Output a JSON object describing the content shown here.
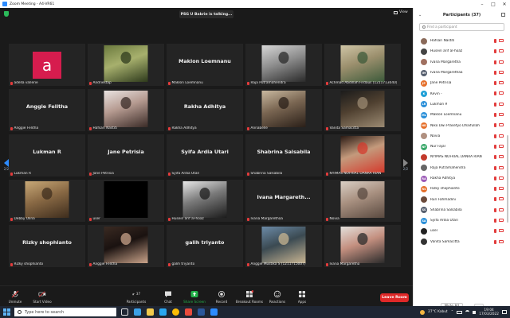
{
  "window": {
    "title": "Zoom Meeting - A4-VR61",
    "controls": [
      "–",
      "□",
      "✕"
    ]
  },
  "banner": {
    "talking": "PSG U Bakrie is talking..."
  },
  "view": {
    "label": "View"
  },
  "pager": {
    "left": "2/2",
    "right": "2/2"
  },
  "tiles": [
    {
      "name": "adella vallerie",
      "kind": "avatar",
      "letter": "a"
    },
    {
      "name": "Andriestap",
      "kind": "photo",
      "palette": [
        "#6b7a3e",
        "#2e3a1c",
        "#a7b06d"
      ]
    },
    {
      "name": "Maklon Loemnanu",
      "kind": "text",
      "big": "Maklon Loemnanu"
    },
    {
      "name": "Raja Putramahendra",
      "kind": "photo",
      "palette": [
        "#d7d7d7",
        "#2a2a2a",
        "#8f8f8f"
      ]
    },
    {
      "name": "Achmad Abdillah Firdaus (1211713040)",
      "kind": "photo",
      "palette": [
        "#cfc5a6",
        "#3c5a3a",
        "#9b8f6d"
      ]
    },
    {
      "name": "Anggie Felitha",
      "kind": "text",
      "big": "Anggie Felitha"
    },
    {
      "name": "Hafsari Nastiti",
      "kind": "photo",
      "palette": [
        "#e9e3e1",
        "#3a2b27",
        "#b59a90"
      ]
    },
    {
      "name": "Rakha Adhitya",
      "kind": "text",
      "big": "Rakha Adhitya"
    },
    {
      "name": "Annabelle",
      "kind": "photo",
      "palette": [
        "#c9b9a0",
        "#2a1f18",
        "#7a6652"
      ]
    },
    {
      "name": "Vanita Samacitta",
      "kind": "photo",
      "palette": [
        "#1b1b1b",
        "#9b8a72",
        "#4f4030"
      ]
    },
    {
      "name": "Lukman R",
      "kind": "text",
      "big": "Lukman R"
    },
    {
      "name": "Jane Petrisia",
      "kind": "text",
      "big": "Jane Petrisia"
    },
    {
      "name": "Syifa Ardia Utari",
      "kind": "text",
      "big": "Syifa Ardia Utari"
    },
    {
      "name": "Shabrina Salsabila",
      "kind": "text",
      "big": "Shabrina Salsabila"
    },
    {
      "name": "NYIMAS NOFRIAL DANRA RIAN",
      "kind": "photo",
      "palette": [
        "#2a1a14",
        "#d43a2c",
        "#c49a7c"
      ]
    },
    {
      "name": "Debby Ulina",
      "kind": "photo",
      "palette": [
        "#c8a978",
        "#3e2d1d",
        "#8a6a45"
      ]
    },
    {
      "name": "user",
      "kind": "black"
    },
    {
      "name": "Husein arif al-hoaz",
      "kind": "photo",
      "palette": [
        "#e8e8e8",
        "#1c1c1c",
        "#7a7a7a"
      ]
    },
    {
      "name": "Ivana Margarethaa",
      "kind": "text",
      "big": "Ivana Margareth..."
    },
    {
      "name": "Novia",
      "kind": "photo",
      "palette": [
        "#d9cfc5",
        "#5a4a40",
        "#a89080"
      ]
    },
    {
      "name": "Rizky shophianto",
      "kind": "text",
      "big": "Rizky shophianto"
    },
    {
      "name": "Anggie Felitha",
      "kind": "photo",
      "palette": [
        "#3a2a22",
        "#caa38a",
        "#1a1210"
      ]
    },
    {
      "name": "galih triyanto",
      "kind": "text",
      "big": "galih triyanto"
    },
    {
      "name": "Anggie Mustika S (1211715007)",
      "kind": "photo",
      "palette": [
        "#6c8ba8",
        "#c8b592",
        "#3b4a52"
      ]
    },
    {
      "name": "Ivana Margaretha",
      "kind": "photo",
      "palette": [
        "#e3e0dc",
        "#2b2b2b",
        "#c49080"
      ]
    }
  ],
  "toolbar": {
    "unmute": "Unmute",
    "start_video": "Start Video",
    "participants": "Participants",
    "participants_count": "37",
    "chat": "Chat",
    "share_screen": "Share Screen",
    "record": "Record",
    "breakout_rooms": "Breakout Rooms",
    "reactions": "Reactions",
    "apps": "Apps",
    "leave": "Leave Room"
  },
  "panel": {
    "title": "Participants (37)",
    "search_placeholder": "Find a participant",
    "participants": [
      {
        "name": "Hafsari Nastiti",
        "initials": "",
        "color": "#8a6a5a"
      },
      {
        "name": "Husein arif al-hoaz",
        "initials": "",
        "color": "#444444"
      },
      {
        "name": "Ivana Margaretha",
        "initials": "",
        "color": "#a07060"
      },
      {
        "name": "Ivana Margarethaa",
        "initials": "IM",
        "color": "#555e6e"
      },
      {
        "name": "Jane Petrisia",
        "initials": "JP",
        "color": "#e56f2a"
      },
      {
        "name": "Kevin -",
        "initials": "K",
        "color": "#1e9fd6"
      },
      {
        "name": "Lukman R",
        "initials": "LR",
        "color": "#2a8fd8"
      },
      {
        "name": "Maklon Loemnanu",
        "initials": "ML",
        "color": "#2a8fd8"
      },
      {
        "name": "Niko Dwi Prasetyo Dhaifullah",
        "initials": "ND",
        "color": "#e56f2a"
      },
      {
        "name": "Novia",
        "initials": "",
        "color": "#b09080"
      },
      {
        "name": "Nur Fajar",
        "initials": "NF",
        "color": "#3aa86a"
      },
      {
        "name": "NYIMAS NOFRIAL DANRA RIAN",
        "initials": "",
        "color": "#c33a2c"
      },
      {
        "name": "Raja Putramahendra",
        "initials": "",
        "color": "#666666"
      },
      {
        "name": "Rakha Adhitya",
        "initials": "RA",
        "color": "#9b59b6"
      },
      {
        "name": "Rizky shophianto",
        "initials": "RS",
        "color": "#e56f2a"
      },
      {
        "name": "Ruri Fahmadini",
        "initials": "",
        "color": "#6a4a3a"
      },
      {
        "name": "Shabrina Salsabila",
        "initials": "SS",
        "color": "#555e6e"
      },
      {
        "name": "Syifa Ardia Utari",
        "initials": "SA",
        "color": "#2a8fd8"
      },
      {
        "name": "user",
        "initials": "",
        "color": "#222222"
      },
      {
        "name": "Vanita Samacitta",
        "initials": "",
        "color": "#333333"
      }
    ],
    "mute_all": "Mute All",
    "more": "...",
    "chat_title": "Chat"
  },
  "taskbar": {
    "search_placeholder": "Type here to search",
    "weather": "27°C Kabut",
    "time": "19:04",
    "date": "17/03/2022"
  }
}
